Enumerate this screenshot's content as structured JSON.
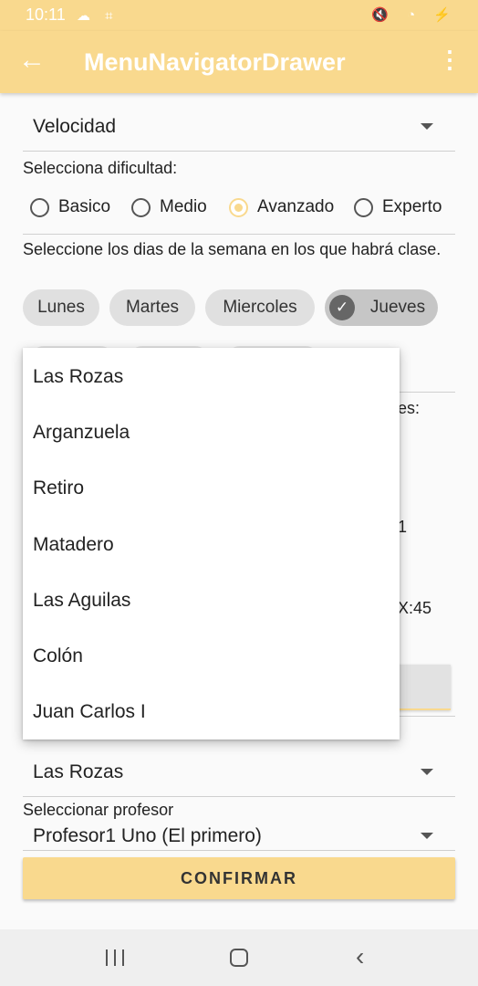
{
  "status_bar": {
    "time": "10:11",
    "left_icons": "☁ ⌗",
    "right_icons": "🔇 ◔ ⚡"
  },
  "app_bar": {
    "title": "MenuNavigatorDrawer",
    "back_glyph": "←",
    "more_glyph": "⋮"
  },
  "form": {
    "type_spinner_value": "Velocidad",
    "difficulty_label": "Selecciona dificultad:",
    "difficulty_options": [
      "Basico",
      "Medio",
      "Avanzado",
      "Experto"
    ],
    "difficulty_selected": "Avanzado",
    "days_label": "Seleccione los dias de la semana en los que habrá clase.",
    "days_chips": [
      "Lunes",
      "Martes",
      "Miercoles",
      "Jueves"
    ],
    "days_checked": [
      "Jueves"
    ],
    "peek_text_1": "es:",
    "peek_text_2": "1",
    "peek_text_3": "X:45",
    "location_spinner_value": "Las Rozas",
    "teacher_label": "Seleccionar profesor",
    "teacher_spinner_value": "Profesor1 Uno (El primero)",
    "confirm_label": "CONFIRMAR"
  },
  "dropdown": {
    "items": [
      "Las Rozas",
      "Arganzuela",
      "Retiro",
      "Matadero",
      "Las Aguilas",
      "Colón",
      "Juan Carlos I"
    ]
  },
  "nav_bar": {
    "back_glyph": "‹"
  },
  "colors": {
    "accent": "#f9d98e",
    "background": "#fafafa"
  }
}
